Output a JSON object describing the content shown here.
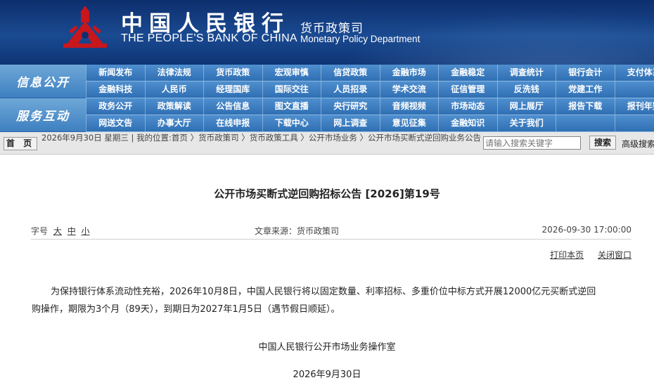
{
  "header": {
    "name_cn": "中国人民银行",
    "name_en": "THE PEOPLE'S BANK OF CHINA",
    "dept_cn": "货币政策司",
    "dept_en": "Monetary Policy Department",
    "logo_icon": "pboc-emblem-icon",
    "brand_color": "#c8161d"
  },
  "nav": {
    "section1": "信息公开",
    "section2": "服务互动",
    "row1": [
      "新闻发布",
      "法律法规",
      "货币政策",
      "宏观审慎",
      "信贷政策",
      "金融市场",
      "金融稳定",
      "调查统计",
      "银行会计",
      "支付体系"
    ],
    "row2": [
      "金融科技",
      "人民币",
      "经理国库",
      "国际交往",
      "人员招录",
      "学术交流",
      "征信管理",
      "反洗钱",
      "党建工作",
      ""
    ],
    "row3": [
      "政务公开",
      "政策解读",
      "公告信息",
      "图文直播",
      "央行研究",
      "音频视频",
      "市场动态",
      "网上展厅",
      "报告下载",
      "报刊年鉴"
    ],
    "row4": [
      "网送文告",
      "办事大厅",
      "在线申报",
      "下载中心",
      "网上调查",
      "意见征集",
      "金融知识",
      "关于我们",
      "",
      ""
    ]
  },
  "crumbbar": {
    "home": "首 页",
    "date": "2026年9月30日 星期三",
    "location": "我的位置:首页 〉货币政策司 〉货币政策工具 〉公开市场业务 〉公开市场买断式逆回购业务公告",
    "search_placeholder": "请输入搜索关键字",
    "search_button": "搜索",
    "advanced": "高级搜索"
  },
  "article": {
    "title": "公开市场买断式逆回购招标公告 [2026]第19号",
    "font_label": "字号",
    "font_large": "大",
    "font_medium": "中",
    "font_small": "小",
    "source": "文章来源：货币政策司",
    "datetime": "2026-09-30 17:00:00",
    "print": "打印本页",
    "close": "关闭窗口",
    "para1": "为保持银行体系流动性充裕，2026年10月8日，中国人民银行将以固定数量、利率招标、多重价位中标方式开展12000亿元买断式逆回",
    "para2": "购操作，期限为3个月（89天），到期日为2027年1月5日（遇节假日顺延）。",
    "signature": "中国人民银行公开市场业务操作室",
    "sign_date": "2026年9月30日"
  }
}
